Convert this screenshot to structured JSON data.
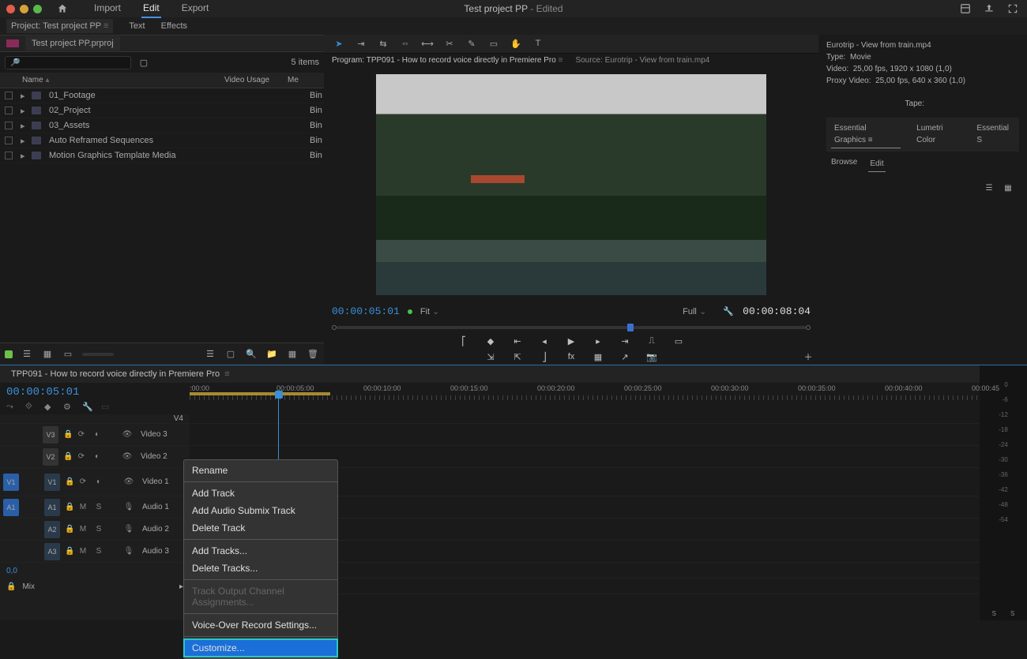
{
  "title_bar": {
    "document_title": "Test project PP",
    "edited_suffix": "- Edited",
    "nav": {
      "import": "Import",
      "edit": "Edit",
      "export": "Export"
    }
  },
  "sub_nav": {
    "project_prefix": "Project: Test project PP",
    "text_tab": "Text",
    "effects_tab": "Effects"
  },
  "project_panel": {
    "file": "Test project PP.prproj",
    "item_count": "5 items",
    "columns": {
      "name": "Name",
      "video_usage": "Video Usage",
      "me": "Me"
    },
    "bins": [
      {
        "name": "01_Footage",
        "me": "Bin"
      },
      {
        "name": "02_Project",
        "me": "Bin"
      },
      {
        "name": "03_Assets",
        "me": "Bin"
      },
      {
        "name": "Auto Reframed Sequences",
        "me": "Bin"
      },
      {
        "name": "Motion Graphics Template Media",
        "me": "Bin"
      }
    ]
  },
  "program": {
    "label": "Program: TPP091 - How to record voice directly in Premiere Pro",
    "source_label": "Source: Eurotrip - View from train.mp4",
    "timecode": "00:00:05:01",
    "fit": "Fit",
    "full": "Full",
    "duration": "00:00:08:04"
  },
  "metadata": {
    "clip_name": "Eurotrip - View from train.mp4",
    "type_label": "Type:",
    "type_value": "Movie",
    "video_label": "Video:",
    "video_value": "25,00 fps, 1920 x 1080 (1,0)",
    "proxy_label": "Proxy Video:",
    "proxy_value": "25,00 fps, 640 x 360 (1,0)",
    "tape_label": "Tape:"
  },
  "right_tabs": {
    "eg": "Essential Graphics",
    "lumetri": "Lumetri Color",
    "es": "Essential S",
    "browse": "Browse",
    "edit": "Edit"
  },
  "timeline": {
    "sequence": "TPP091 - How to record voice directly in Premiere Pro",
    "playhead_tc": "00:00:05:01",
    "ruler": [
      ":00:00",
      "00:00:05:00",
      "00:00:10:00",
      "00:00:15:00",
      "00:00:20:00",
      "00:00:25:00",
      "00:00:30:00",
      "00:00:35:00",
      "00:00:40:00",
      "00:00:45"
    ],
    "video_tracks": [
      {
        "id": "V4",
        "label": ""
      },
      {
        "id": "V3",
        "label": "Video 3"
      },
      {
        "id": "V2",
        "label": "Video 2"
      },
      {
        "id": "V1",
        "label": "Video 1"
      }
    ],
    "audio_tracks": [
      {
        "id": "A1",
        "label": "Audio 1"
      },
      {
        "id": "A2",
        "label": "Audio 2"
      },
      {
        "id": "A3",
        "label": "Audio 3"
      }
    ],
    "mix": "Mix",
    "balance": "0,0"
  },
  "context_menu": {
    "items": [
      {
        "label": "Rename",
        "disabled": false
      },
      {
        "sep": true
      },
      {
        "label": "Add Track",
        "disabled": false
      },
      {
        "label": "Add Audio Submix Track",
        "disabled": false
      },
      {
        "label": "Delete Track",
        "disabled": false
      },
      {
        "sep": true
      },
      {
        "label": "Add Tracks...",
        "disabled": false
      },
      {
        "label": "Delete Tracks...",
        "disabled": false
      },
      {
        "sep": true
      },
      {
        "label": "Track Output Channel Assignments...",
        "disabled": true
      },
      {
        "sep": true
      },
      {
        "label": "Voice-Over Record Settings...",
        "disabled": false
      },
      {
        "sep": true
      },
      {
        "label": "Customize...",
        "disabled": false,
        "selected": true
      }
    ]
  },
  "meters": {
    "scale": [
      "0",
      "-6",
      "-12",
      "-18",
      "-24",
      "-30",
      "-36",
      "-42",
      "-48",
      "-54"
    ],
    "s_left": "S",
    "s_right": "S"
  }
}
